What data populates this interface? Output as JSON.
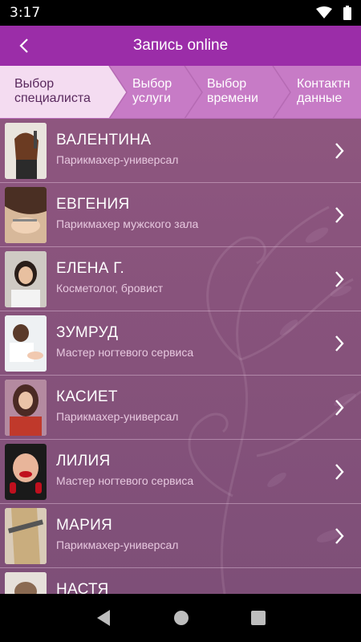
{
  "status_bar": {
    "time": "3:17"
  },
  "app_bar": {
    "title": "Запись online"
  },
  "steps": [
    {
      "label": "Выбор\nспециалиста",
      "active": true
    },
    {
      "label": "Выбор\nуслуги",
      "active": false
    },
    {
      "label": "Выбор\nвремени",
      "active": false
    },
    {
      "label": "Контактн\nданные",
      "active": false
    }
  ],
  "specialists": [
    {
      "name": "ВАЛЕНТИНА",
      "role": "Парикмахер-универсал"
    },
    {
      "name": "ЕВГЕНИЯ",
      "role": "Парикмахер мужского зала"
    },
    {
      "name": "ЕЛЕНА Г.",
      "role": "Косметолог, бровист"
    },
    {
      "name": "ЗУМРУД",
      "role": "Мастер ногтевого сервиса"
    },
    {
      "name": "КАСИЕТ",
      "role": "Парикмахер-универсал"
    },
    {
      "name": "ЛИЛИЯ",
      "role": "Мастер ногтевого сервиса"
    },
    {
      "name": "МАРИЯ",
      "role": "Парикмахер-универсал"
    },
    {
      "name": "НАСТЯ",
      "role": ""
    }
  ],
  "colors": {
    "app_bar": "#9b2da8",
    "steps_bg": "#c77bc6",
    "list_bg": "#86527b"
  }
}
